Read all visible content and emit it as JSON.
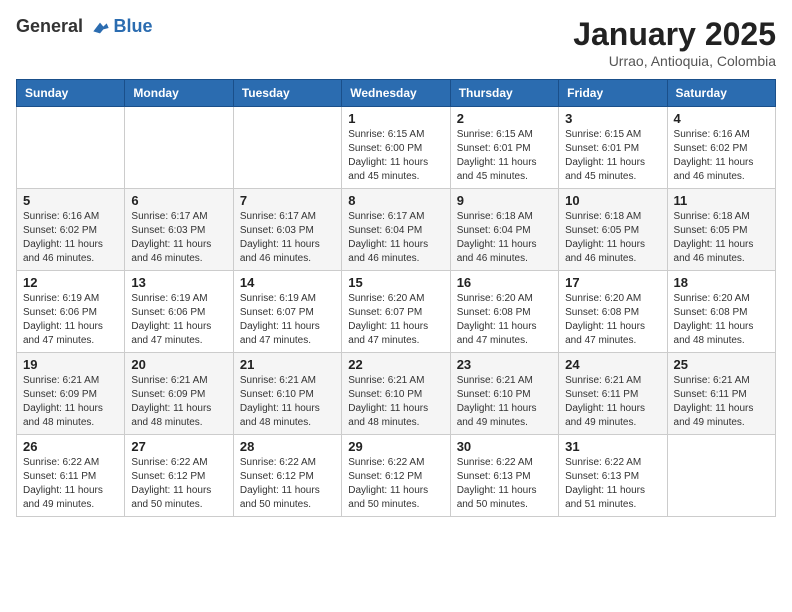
{
  "header": {
    "logo_general": "General",
    "logo_blue": "Blue",
    "month": "January 2025",
    "location": "Urrao, Antioquia, Colombia"
  },
  "weekdays": [
    "Sunday",
    "Monday",
    "Tuesday",
    "Wednesday",
    "Thursday",
    "Friday",
    "Saturday"
  ],
  "weeks": [
    [
      {
        "day": "",
        "info": ""
      },
      {
        "day": "",
        "info": ""
      },
      {
        "day": "",
        "info": ""
      },
      {
        "day": "1",
        "info": "Sunrise: 6:15 AM\nSunset: 6:00 PM\nDaylight: 11 hours\nand 45 minutes."
      },
      {
        "day": "2",
        "info": "Sunrise: 6:15 AM\nSunset: 6:01 PM\nDaylight: 11 hours\nand 45 minutes."
      },
      {
        "day": "3",
        "info": "Sunrise: 6:15 AM\nSunset: 6:01 PM\nDaylight: 11 hours\nand 45 minutes."
      },
      {
        "day": "4",
        "info": "Sunrise: 6:16 AM\nSunset: 6:02 PM\nDaylight: 11 hours\nand 46 minutes."
      }
    ],
    [
      {
        "day": "5",
        "info": "Sunrise: 6:16 AM\nSunset: 6:02 PM\nDaylight: 11 hours\nand 46 minutes."
      },
      {
        "day": "6",
        "info": "Sunrise: 6:17 AM\nSunset: 6:03 PM\nDaylight: 11 hours\nand 46 minutes."
      },
      {
        "day": "7",
        "info": "Sunrise: 6:17 AM\nSunset: 6:03 PM\nDaylight: 11 hours\nand 46 minutes."
      },
      {
        "day": "8",
        "info": "Sunrise: 6:17 AM\nSunset: 6:04 PM\nDaylight: 11 hours\nand 46 minutes."
      },
      {
        "day": "9",
        "info": "Sunrise: 6:18 AM\nSunset: 6:04 PM\nDaylight: 11 hours\nand 46 minutes."
      },
      {
        "day": "10",
        "info": "Sunrise: 6:18 AM\nSunset: 6:05 PM\nDaylight: 11 hours\nand 46 minutes."
      },
      {
        "day": "11",
        "info": "Sunrise: 6:18 AM\nSunset: 6:05 PM\nDaylight: 11 hours\nand 46 minutes."
      }
    ],
    [
      {
        "day": "12",
        "info": "Sunrise: 6:19 AM\nSunset: 6:06 PM\nDaylight: 11 hours\nand 47 minutes."
      },
      {
        "day": "13",
        "info": "Sunrise: 6:19 AM\nSunset: 6:06 PM\nDaylight: 11 hours\nand 47 minutes."
      },
      {
        "day": "14",
        "info": "Sunrise: 6:19 AM\nSunset: 6:07 PM\nDaylight: 11 hours\nand 47 minutes."
      },
      {
        "day": "15",
        "info": "Sunrise: 6:20 AM\nSunset: 6:07 PM\nDaylight: 11 hours\nand 47 minutes."
      },
      {
        "day": "16",
        "info": "Sunrise: 6:20 AM\nSunset: 6:08 PM\nDaylight: 11 hours\nand 47 minutes."
      },
      {
        "day": "17",
        "info": "Sunrise: 6:20 AM\nSunset: 6:08 PM\nDaylight: 11 hours\nand 47 minutes."
      },
      {
        "day": "18",
        "info": "Sunrise: 6:20 AM\nSunset: 6:08 PM\nDaylight: 11 hours\nand 48 minutes."
      }
    ],
    [
      {
        "day": "19",
        "info": "Sunrise: 6:21 AM\nSunset: 6:09 PM\nDaylight: 11 hours\nand 48 minutes."
      },
      {
        "day": "20",
        "info": "Sunrise: 6:21 AM\nSunset: 6:09 PM\nDaylight: 11 hours\nand 48 minutes."
      },
      {
        "day": "21",
        "info": "Sunrise: 6:21 AM\nSunset: 6:10 PM\nDaylight: 11 hours\nand 48 minutes."
      },
      {
        "day": "22",
        "info": "Sunrise: 6:21 AM\nSunset: 6:10 PM\nDaylight: 11 hours\nand 48 minutes."
      },
      {
        "day": "23",
        "info": "Sunrise: 6:21 AM\nSunset: 6:10 PM\nDaylight: 11 hours\nand 49 minutes."
      },
      {
        "day": "24",
        "info": "Sunrise: 6:21 AM\nSunset: 6:11 PM\nDaylight: 11 hours\nand 49 minutes."
      },
      {
        "day": "25",
        "info": "Sunrise: 6:21 AM\nSunset: 6:11 PM\nDaylight: 11 hours\nand 49 minutes."
      }
    ],
    [
      {
        "day": "26",
        "info": "Sunrise: 6:22 AM\nSunset: 6:11 PM\nDaylight: 11 hours\nand 49 minutes."
      },
      {
        "day": "27",
        "info": "Sunrise: 6:22 AM\nSunset: 6:12 PM\nDaylight: 11 hours\nand 50 minutes."
      },
      {
        "day": "28",
        "info": "Sunrise: 6:22 AM\nSunset: 6:12 PM\nDaylight: 11 hours\nand 50 minutes."
      },
      {
        "day": "29",
        "info": "Sunrise: 6:22 AM\nSunset: 6:12 PM\nDaylight: 11 hours\nand 50 minutes."
      },
      {
        "day": "30",
        "info": "Sunrise: 6:22 AM\nSunset: 6:13 PM\nDaylight: 11 hours\nand 50 minutes."
      },
      {
        "day": "31",
        "info": "Sunrise: 6:22 AM\nSunset: 6:13 PM\nDaylight: 11 hours\nand 51 minutes."
      },
      {
        "day": "",
        "info": ""
      }
    ]
  ]
}
